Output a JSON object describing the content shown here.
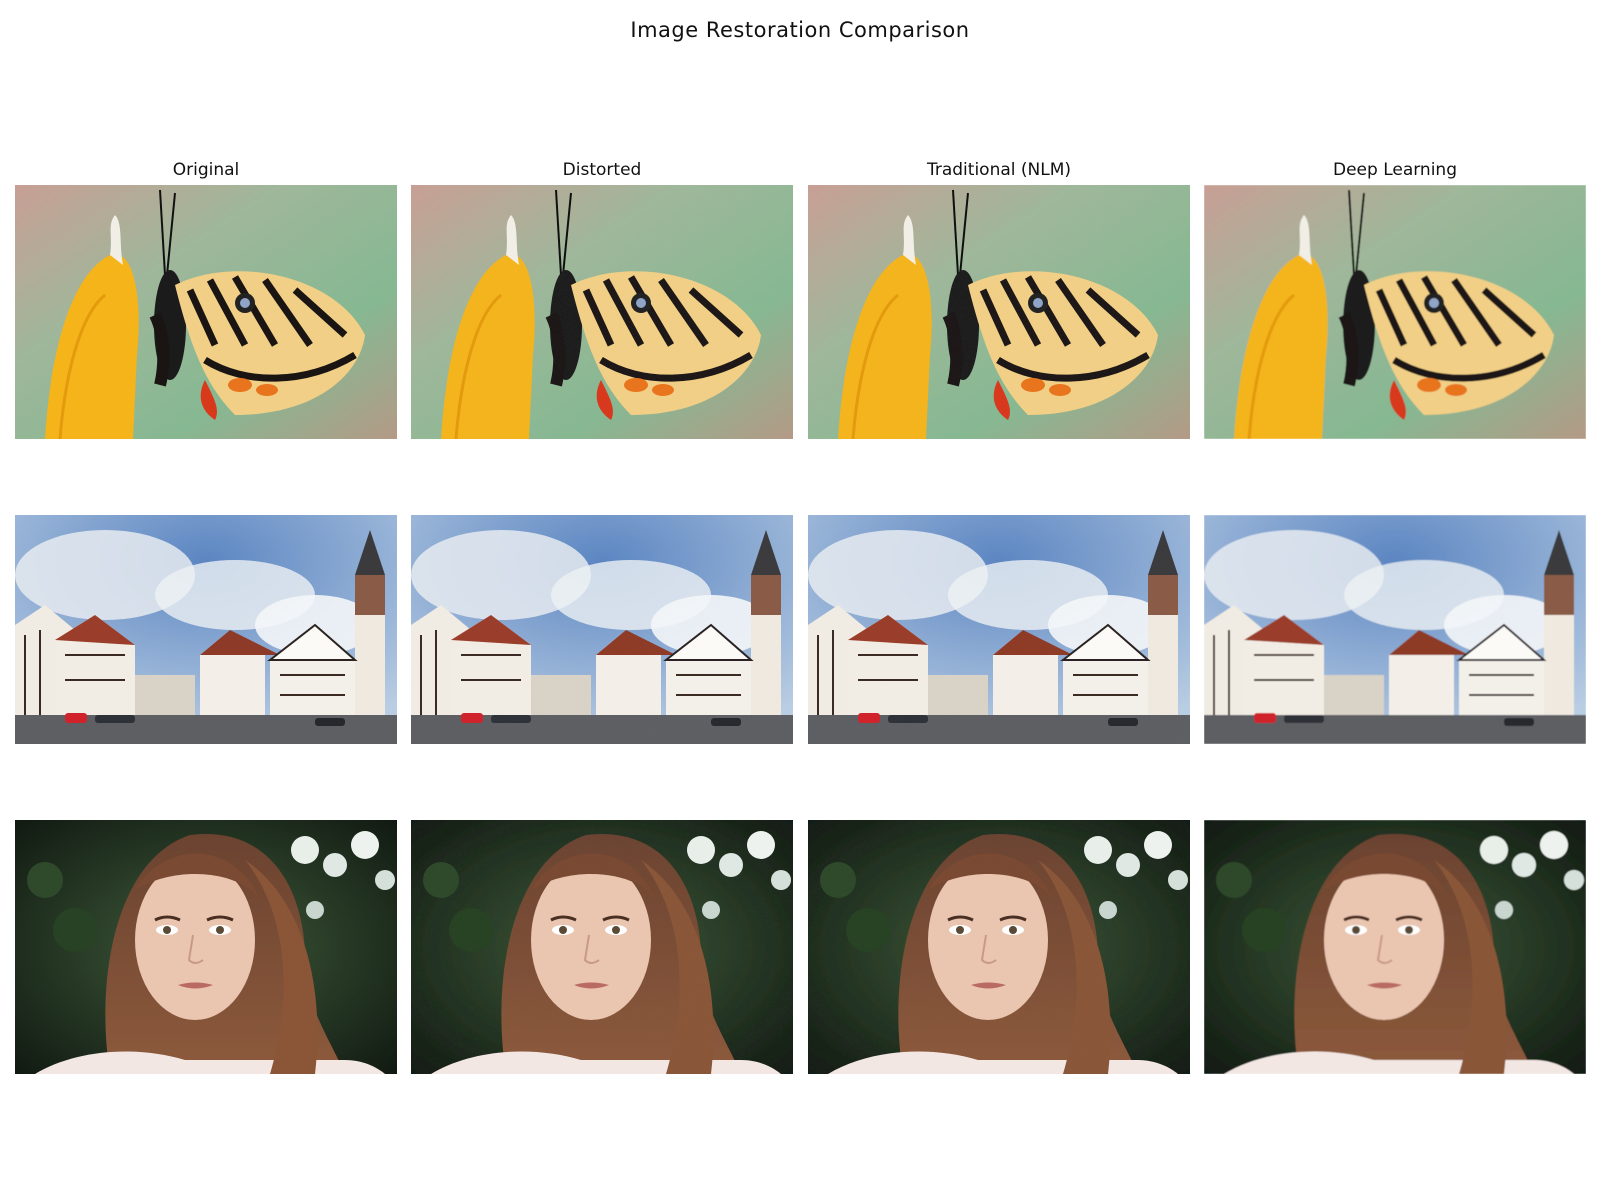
{
  "figure": {
    "title": "Image Restoration Comparison"
  },
  "columns": [
    "Original",
    "Distorted",
    "Traditional (NLM)",
    "Deep Learning"
  ],
  "rows": [
    {
      "subject": "butterfly-on-yellow-flower"
    },
    {
      "subject": "half-timbered-town-square"
    },
    {
      "subject": "portrait-of-woman"
    }
  ],
  "colors": {
    "background": "#ffffff",
    "text": "#111111"
  }
}
